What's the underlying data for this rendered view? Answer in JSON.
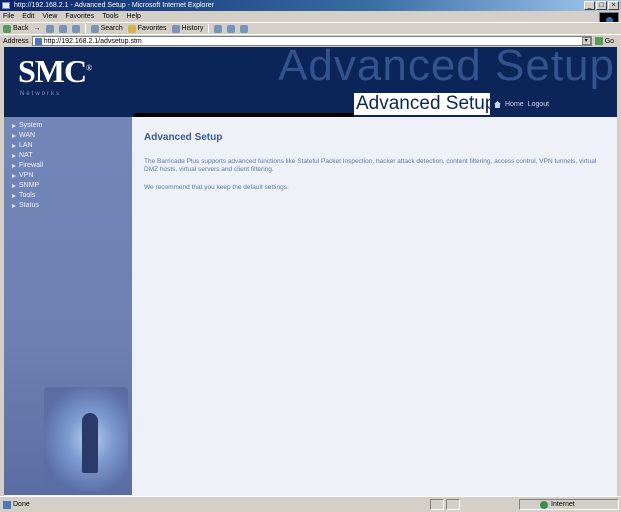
{
  "window": {
    "title": "http://192.168.2.1 - Advanced Setup - Microsoft Internet Explorer",
    "minimize": "_",
    "maximize": "□",
    "close": "×"
  },
  "menu": [
    "File",
    "Edit",
    "View",
    "Favorites",
    "Tools",
    "Help"
  ],
  "toolbar": {
    "back": "Back",
    "forward": "→",
    "search": "Search",
    "favorites": "Favorites",
    "history": "History"
  },
  "address": {
    "label": "Address",
    "url": "http://192.168.2.1/advsetup.stm",
    "go": "Go"
  },
  "header": {
    "logo": "SMC",
    "logo_reg": "®",
    "tagline": "Networks",
    "watermark": "Advanced Setup",
    "page_title": "Advanced Setup",
    "home": "Home",
    "logout": "Logout"
  },
  "nav": [
    "System",
    "WAN",
    "LAN",
    "NAT",
    "Firewall",
    "VPN",
    "SNMP",
    "Tools",
    "Status"
  ],
  "content": {
    "title": "Advanced Setup",
    "intro": "The Barricade Plus supports advanced functions like Stateful Packet Inspection, hacker attack detection, content filtering, access control, VPN tunnels, virtual DMZ hosts, virtual servers and client filtering.",
    "advice": "We recommend that you keep the default settings."
  },
  "status": {
    "text": "Done",
    "zone": "Internet"
  },
  "colors": {
    "header_bg": "#0b2558",
    "sidebar_bg": "#7386b8",
    "content_bg": "#eef1f8",
    "accent": "#3c5a94"
  }
}
